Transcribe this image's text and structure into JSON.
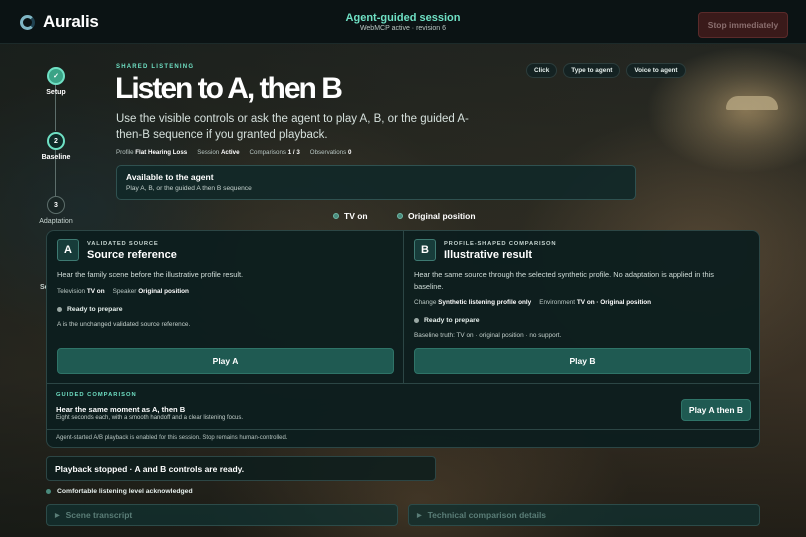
{
  "app": {
    "name": "Auralis"
  },
  "session": {
    "title": "Agent-guided session",
    "subtitle": "WebMCP active · revision 6",
    "stop_label": "Stop immediately"
  },
  "steps": [
    {
      "label": "Setup",
      "marker": "✓",
      "state": "done"
    },
    {
      "label": "Baseline",
      "marker": "2",
      "state": "current"
    },
    {
      "label": "Adaptation",
      "marker": "3",
      "state": "upcoming"
    }
  ],
  "stepper_peek": "Se",
  "hero": {
    "eyebrow": "SHARED LISTENING",
    "title": "Listen to A, then B",
    "lead": "Use the visible controls or ask the agent to play A, B, or the guided A-then-B sequence if you granted playback."
  },
  "meta": {
    "profile_label": "Profile",
    "profile_value": "Flat Hearing Loss",
    "session_label": "Session",
    "session_value": "Active",
    "comparisons_label": "Comparisons",
    "comparisons_value": "1 / 3",
    "observations_label": "Observations",
    "observations_value": "0"
  },
  "modes": [
    "Click",
    "Type to agent",
    "Voice to agent"
  ],
  "available": {
    "title": "Available to the agent",
    "subtitle": "Play A, B, or the guided A then B sequence"
  },
  "status": {
    "tv": "TV on",
    "position": "Original position"
  },
  "column_a": {
    "badge": "A",
    "eyebrow": "VALIDATED SOURCE",
    "title": "Source reference",
    "description": "Hear the family scene before the illustrative profile result.",
    "kv": [
      {
        "label": "Television",
        "value": "TV on"
      },
      {
        "label": "Speaker",
        "value": "Original position"
      }
    ],
    "ready": "Ready to prepare",
    "note": "A is the unchanged validated source reference.",
    "play_label": "Play A"
  },
  "column_b": {
    "badge": "B",
    "eyebrow": "PROFILE-SHAPED COMPARISON",
    "title": "Illustrative result",
    "description": "Hear the same source through the selected synthetic profile. No adaptation is applied in this baseline.",
    "kv": [
      {
        "label": "Change",
        "value": "Synthetic listening profile only"
      },
      {
        "label": "Environment",
        "value": "TV on · Original position"
      }
    ],
    "ready": "Ready to prepare",
    "note": "Baseline truth: TV on · original position · no support.",
    "play_label": "Play B"
  },
  "guided": {
    "eyebrow": "GUIDED COMPARISON",
    "title": "Hear the same moment as A, then B",
    "subtitle": "Eight seconds each, with a smooth handoff and a clear listening focus.",
    "button": "Play A then B"
  },
  "footer_note": "Agent-started A/B playback is enabled for this session. Stop remains human-controlled.",
  "toast": "Playback stopped · A and B controls are ready.",
  "ack": "Comfortable listening level acknowledged",
  "disclosures": [
    "Scene transcript",
    "Technical comparison details"
  ],
  "colors": {
    "accent": "#6fe0c4",
    "primary_button": "#1f5a52",
    "stop_button": "#3a1a1a"
  }
}
